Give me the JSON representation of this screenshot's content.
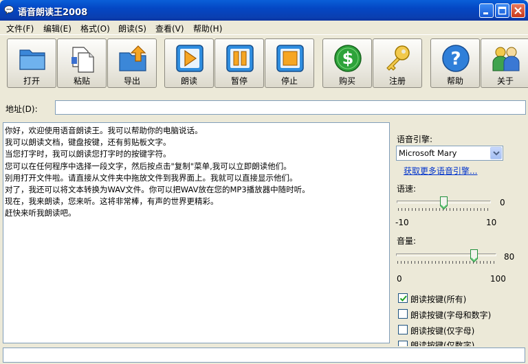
{
  "window": {
    "title": "语音朗读王2008"
  },
  "menu": [
    {
      "label": "文件(F)"
    },
    {
      "label": "编辑(E)"
    },
    {
      "label": "格式(O)"
    },
    {
      "label": "朗读(S)"
    },
    {
      "label": "查看(V)"
    },
    {
      "label": "帮助(H)"
    }
  ],
  "toolbar": [
    {
      "label": "打开",
      "icon": "folder-icon"
    },
    {
      "label": "粘贴",
      "icon": "paste-icon"
    },
    {
      "label": "导出",
      "icon": "export-icon"
    },
    {
      "label": "朗读",
      "icon": "play-icon"
    },
    {
      "label": "暂停",
      "icon": "pause-icon"
    },
    {
      "label": "停止",
      "icon": "stop-icon"
    },
    {
      "label": "购买",
      "icon": "dollar-icon"
    },
    {
      "label": "注册",
      "icon": "key-icon"
    },
    {
      "label": "帮助",
      "icon": "help-icon"
    },
    {
      "label": "关于",
      "icon": "users-icon"
    }
  ],
  "address": {
    "label": "地址(D):",
    "value": ""
  },
  "text_lines": [
    "你好，欢迎使用语音朗读王。我可以帮助你的电脑说话。",
    "我可以朗读文档，键盘按键，还有剪贴板文字。",
    "当您打字时，我可以朗读您打字时的按键字符。",
    "您可以在任何程序中选择一段文字，然后按点击\"复制\"菜单,我可以立即朗读他们。",
    "别用打开文件啦。请直接从文件夹中拖放文件到我界面上。我就可以直接显示他们。",
    "对了，我还可以将文本转换为WAV文件。你可以把WAV放在您的MP3播放器中随时听。",
    "现在，我来朗读，您来听。这将非常棒，有声的世界更精彩。",
    "赶快来听我朗读吧。"
  ],
  "panel": {
    "engine_label": "语音引擎:",
    "engine_value": "Microsoft Mary",
    "more_engines_link": "获取更多语音引擎...",
    "speed": {
      "label": "语速:",
      "value": "0",
      "min": "-10",
      "max": "10",
      "level": 0.5
    },
    "volume": {
      "label": "音量:",
      "value": "80",
      "min": "0",
      "max": "100",
      "level": 0.8
    },
    "checkboxes": [
      {
        "label": "朗读按键(所有)",
        "checked": true
      },
      {
        "label": "朗读按键(字母和数字)",
        "checked": false
      },
      {
        "label": "朗读按键(仅字母)",
        "checked": false
      },
      {
        "label": "朗读按键(仅数字)",
        "checked": false
      }
    ]
  },
  "status": {
    "text": ""
  },
  "colors": {
    "title_bar": "#0a4fd0",
    "chrome": "#ece9d8",
    "link": "#0033cc",
    "field_border": "#7f9db9"
  }
}
